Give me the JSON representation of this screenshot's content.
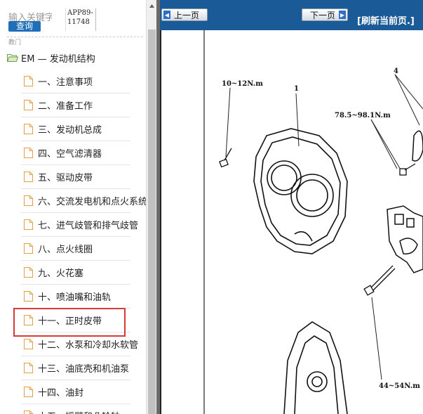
{
  "search": {
    "label": "输入关键字",
    "button_label": "查询",
    "app_code": "APP89-11748"
  },
  "tree": {
    "caption": "教门",
    "root_label": "EM — 发动机结构",
    "items": [
      {
        "label": "一、注意事项"
      },
      {
        "label": "二、准备工作"
      },
      {
        "label": "三、发动机总成"
      },
      {
        "label": "四、空气滤清器"
      },
      {
        "label": "五、驱动皮带"
      },
      {
        "label": "六、交流发电机和点火系统"
      },
      {
        "label": "七、进气歧管和排气歧管"
      },
      {
        "label": "八、点火线圈"
      },
      {
        "label": "九、火花塞"
      },
      {
        "label": "十、喷油嘴和油轨"
      },
      {
        "label": "十一、正时皮带"
      },
      {
        "label": "十二、水泵和冷却水软管"
      },
      {
        "label": "十三、油底壳和机油泵"
      },
      {
        "label": "十四、油封"
      },
      {
        "label": "十五、摇臂和凸轮轴"
      }
    ],
    "highlighted_index": 10
  },
  "toolbar": {
    "prev_label": "上一页",
    "next_label": "下一页",
    "refresh_label": "[刷新当前页.]"
  },
  "diagram": {
    "torque_1": "10~12N.m",
    "torque_2": "78.5~98.1N.m",
    "torque_3": "44~54N.m",
    "part_1": "1",
    "part_4": "4"
  },
  "colors": {
    "toolbar_bg": "#1a5a96",
    "button_blue": "#1e6fb8",
    "highlight_red": "#d63b3b"
  }
}
